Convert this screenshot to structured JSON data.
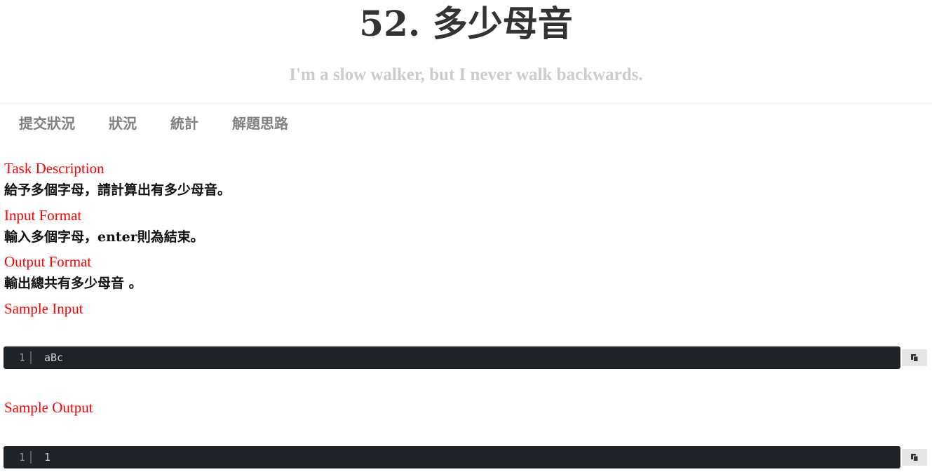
{
  "header": {
    "title": "52. 多少母音",
    "subtitle": "I'm a slow walker, but I never walk backwards."
  },
  "tabs": [
    {
      "label": "提交狀況"
    },
    {
      "label": "狀況"
    },
    {
      "label": "統計"
    },
    {
      "label": "解題思路"
    }
  ],
  "sections": {
    "task_description": {
      "label": "Task Description",
      "text": "給予多個字母，請計算出有多少母音。"
    },
    "input_format": {
      "label": "Input Format",
      "text": "輸入多個字母，enter則為結束。"
    },
    "output_format": {
      "label": "Output Format",
      "text": "輸出總共有多少母音 。"
    },
    "sample_input": {
      "label": "Sample Input",
      "line_number": "1",
      "code": "aBc"
    },
    "sample_output": {
      "label": "Sample Output",
      "line_number": "1",
      "code": "1"
    }
  },
  "icons": {
    "copy": "copy-icon"
  }
}
